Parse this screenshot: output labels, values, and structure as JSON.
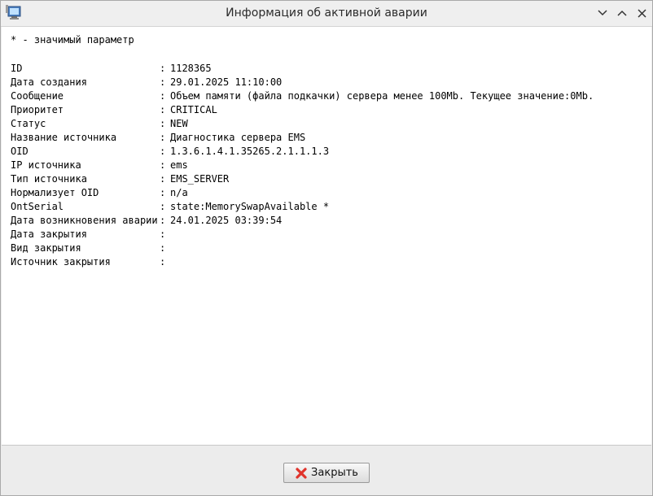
{
  "window": {
    "title": "Информация об активной аварии",
    "app_icon": "app-monitor-icon",
    "controls": {
      "minimize_icon": "chevron-down-icon",
      "maximize_icon": "chevron-up-icon",
      "close_icon": "close-icon"
    }
  },
  "note": "* - значимый параметр",
  "fields": [
    {
      "label": "ID",
      "value": "1128365"
    },
    {
      "label": "Дата создания",
      "value": "29.01.2025 11:10:00"
    },
    {
      "label": "Сообщение",
      "value": "Объем памяти (файла подкачки) сервера менее 100Mb. Текущее значение:0Mb."
    },
    {
      "label": "Приоритет",
      "value": "CRITICAL"
    },
    {
      "label": "Статус",
      "value": "NEW"
    },
    {
      "label": "Название источника",
      "value": "Диагностика сервера EMS"
    },
    {
      "label": "OID",
      "value": "1.3.6.1.4.1.35265.2.1.1.1.3"
    },
    {
      "label": "IP источника",
      "value": "ems"
    },
    {
      "label": "Тип источника",
      "value": "EMS_SERVER"
    },
    {
      "label": "Нормализует OID",
      "value": "n/a"
    },
    {
      "label": "OntSerial",
      "value": "state:MemorySwapAvailable *"
    },
    {
      "label": "Дата возникновения аварии",
      "value": "24.01.2025 03:39:54"
    },
    {
      "label": "Дата закрытия",
      "value": ""
    },
    {
      "label": "Вид закрытия",
      "value": ""
    },
    {
      "label": "Источник закрытия",
      "value": ""
    }
  ],
  "separator": ":",
  "footer": {
    "close_button_label": "Закрыть",
    "close_button_icon": "red-x-icon"
  },
  "colors": {
    "close_icon_red": "#e0332b",
    "window_bg": "#ececec",
    "content_bg": "#ffffff"
  }
}
